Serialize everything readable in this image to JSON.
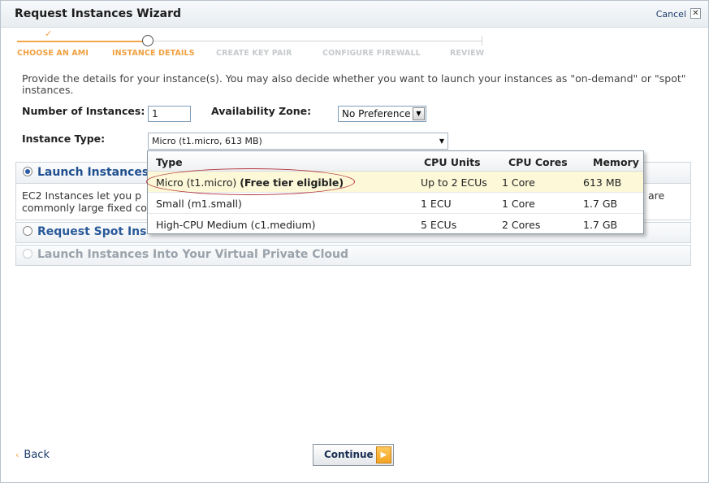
{
  "window": {
    "title": "Request Instances Wizard",
    "cancel_label": "Cancel",
    "close_glyph": "✕"
  },
  "steps": [
    {
      "label": "CHOOSE AN AMI",
      "state": "done"
    },
    {
      "label": "INSTANCE DETAILS",
      "state": "current"
    },
    {
      "label": "CREATE KEY PAIR",
      "state": "todo"
    },
    {
      "label": "CONFIGURE FIREWALL",
      "state": "todo"
    },
    {
      "label": "REVIEW",
      "state": "todo"
    }
  ],
  "intro_text": "Provide the details for your instance(s). You may also decide whether you want to launch your instances as \"on-demand\" or \"spot\" instances.",
  "form": {
    "num_instances_label": "Number of Instances:",
    "num_instances_value": "1",
    "az_label": "Availability Zone:",
    "az_value": "No Preference",
    "instance_type_label": "Instance Type:",
    "instance_type_value": "Micro (t1.micro, 613 MB)"
  },
  "instance_table": {
    "headers": [
      "Type",
      "CPU Units",
      "CPU Cores",
      "Memory"
    ],
    "rows": [
      {
        "type": "Micro (t1.micro)",
        "badge": "(Free tier eligible)",
        "cpu_units": "Up to 2 ECUs",
        "cores": "1 Core",
        "memory": "613 MB",
        "selected": true
      },
      {
        "type": "Small (m1.small)",
        "badge": "",
        "cpu_units": "1 ECU",
        "cores": "1 Core",
        "memory": "1.7 GB",
        "selected": false
      },
      {
        "type": "High-CPU Medium (c1.medium)",
        "badge": "",
        "cpu_units": "5 ECUs",
        "cores": "2 Cores",
        "memory": "1.7 GB",
        "selected": false
      }
    ]
  },
  "sections": {
    "launch": {
      "title": "Launch Instances",
      "body_line1": "EC2 Instances let you p",
      "body_line2": "commonly large fixed co",
      "body_tail": "are"
    },
    "spot": {
      "title": "Request Spot Ins"
    },
    "vpc": {
      "title": "Launch Instances Into Your Virtual Private Cloud"
    }
  },
  "footer": {
    "back_label": "Back",
    "continue_label": "Continue"
  },
  "colors": {
    "accent_orange": "#f0a040",
    "link_blue": "#1d3c6b",
    "highlight_row": "#fcf8d8",
    "annotation_red": "#b2323a"
  }
}
